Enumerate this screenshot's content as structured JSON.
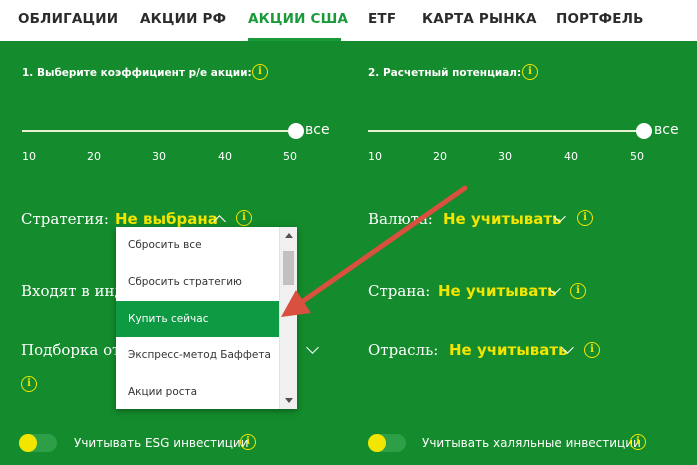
{
  "tabs": [
    {
      "label": "ОБЛИГАЦИИ",
      "active": false
    },
    {
      "label": "АКЦИИ РФ",
      "active": false
    },
    {
      "label": "АКЦИИ США",
      "active": true
    },
    {
      "label": "ETF",
      "active": false
    },
    {
      "label": "КАРТА РЫНКА",
      "active": false
    },
    {
      "label": "ПОРТФЕЛЬ",
      "active": false
    }
  ],
  "step1": {
    "label": "1. Выберите коэффициент р/е акции:",
    "slider_value": "все",
    "ticks": [
      "10",
      "20",
      "30",
      "40",
      "50"
    ]
  },
  "step2": {
    "label": "2. Расчетный потенциал:",
    "slider_value": "все",
    "ticks": [
      "10",
      "20",
      "30",
      "40",
      "50"
    ]
  },
  "filters": {
    "strategy": {
      "label": "Стратегия:",
      "value": "Не выбрана"
    },
    "currency": {
      "label": "Валюта:",
      "value": "Не учитывать"
    },
    "included": {
      "label": "Входят в инд"
    },
    "country": {
      "label": "Страна:",
      "value": "Не учитывать"
    },
    "selection": {
      "label": "Подборка от"
    },
    "industry": {
      "label": "Отрасль:",
      "value": "Не учитывать"
    }
  },
  "dropdown": {
    "items": [
      "Сбросить все",
      "Сбросить стратегию",
      "Купить сейчас",
      "Экспресс-метод Баффета",
      "Акции роста"
    ],
    "selected_index": 2
  },
  "toggles": {
    "esg": {
      "label": "Учитывать ESG инвестиции",
      "enabled": false
    },
    "halal": {
      "label": "Учитывать халяльные инвестиции",
      "enabled": false
    }
  },
  "info_glyph": "i",
  "colors": {
    "background": "#148b2c",
    "accent_yellow": "#f2e600",
    "tab_active": "#1a9a3a",
    "menu_highlight": "#0e9a43",
    "arrow": "#d9503f"
  }
}
